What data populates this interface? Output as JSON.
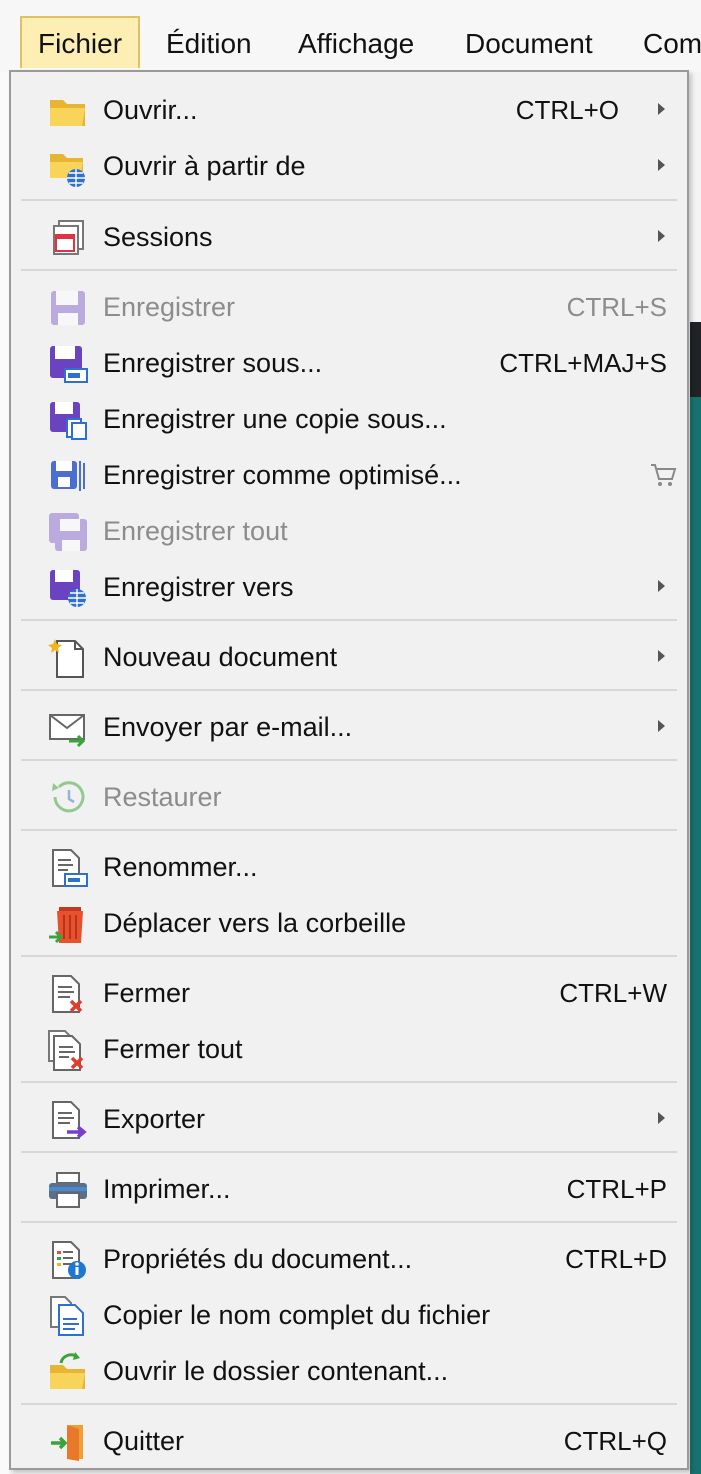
{
  "menubar": {
    "items": [
      "Fichier",
      "Édition",
      "Affichage",
      "Document",
      "Com"
    ]
  },
  "menu": {
    "items": [
      {
        "label": "Ouvrir...",
        "shortcut": "CTRL+O",
        "submenu": true,
        "disabled": false,
        "icon": "folder-icon"
      },
      {
        "label": "Ouvrir à partir de",
        "shortcut": "",
        "submenu": true,
        "disabled": false,
        "icon": "folder-globe-icon"
      },
      {
        "label": "Sessions",
        "shortcut": "",
        "submenu": true,
        "disabled": false,
        "icon": "sessions-icon"
      },
      {
        "label": "Enregistrer",
        "shortcut": "CTRL+S",
        "submenu": false,
        "disabled": true,
        "icon": "save-icon"
      },
      {
        "label": "Enregistrer sous...",
        "shortcut": "CTRL+MAJ+S",
        "submenu": false,
        "disabled": false,
        "icon": "save-as-icon"
      },
      {
        "label": "Enregistrer une copie sous...",
        "shortcut": "",
        "submenu": false,
        "disabled": false,
        "icon": "save-copy-icon"
      },
      {
        "label": "Enregistrer comme optimisé...",
        "shortcut": "",
        "submenu": false,
        "disabled": false,
        "icon": "save-optimized-icon",
        "badge": "cart-icon"
      },
      {
        "label": "Enregistrer tout",
        "shortcut": "",
        "submenu": false,
        "disabled": true,
        "icon": "save-all-icon"
      },
      {
        "label": "Enregistrer vers",
        "shortcut": "",
        "submenu": true,
        "disabled": false,
        "icon": "save-to-icon"
      },
      {
        "label": "Nouveau document",
        "shortcut": "",
        "submenu": true,
        "disabled": false,
        "icon": "new-document-icon"
      },
      {
        "label": "Envoyer par e-mail...",
        "shortcut": "",
        "submenu": true,
        "disabled": false,
        "icon": "email-icon"
      },
      {
        "label": "Restaurer",
        "shortcut": "",
        "submenu": false,
        "disabled": true,
        "icon": "restore-icon"
      },
      {
        "label": "Renommer...",
        "shortcut": "",
        "submenu": false,
        "disabled": false,
        "icon": "rename-icon"
      },
      {
        "label": "Déplacer vers la corbeille",
        "shortcut": "",
        "submenu": false,
        "disabled": false,
        "icon": "trash-icon"
      },
      {
        "label": "Fermer",
        "shortcut": "CTRL+W",
        "submenu": false,
        "disabled": false,
        "icon": "close-document-icon"
      },
      {
        "label": "Fermer tout",
        "shortcut": "",
        "submenu": false,
        "disabled": false,
        "icon": "close-all-icon"
      },
      {
        "label": "Exporter",
        "shortcut": "",
        "submenu": true,
        "disabled": false,
        "icon": "export-icon"
      },
      {
        "label": "Imprimer...",
        "shortcut": "CTRL+P",
        "submenu": false,
        "disabled": false,
        "icon": "printer-icon"
      },
      {
        "label": "Propriétés du document...",
        "shortcut": "CTRL+D",
        "submenu": false,
        "disabled": false,
        "icon": "properties-icon"
      },
      {
        "label": "Copier le nom complet du fichier",
        "shortcut": "",
        "submenu": false,
        "disabled": false,
        "icon": "copy-filename-icon"
      },
      {
        "label": "Ouvrir le dossier contenant...",
        "shortcut": "",
        "submenu": false,
        "disabled": false,
        "icon": "open-folder-icon"
      },
      {
        "label": "Quitter",
        "shortcut": "CTRL+Q",
        "submenu": false,
        "disabled": false,
        "icon": "exit-icon"
      }
    ]
  }
}
